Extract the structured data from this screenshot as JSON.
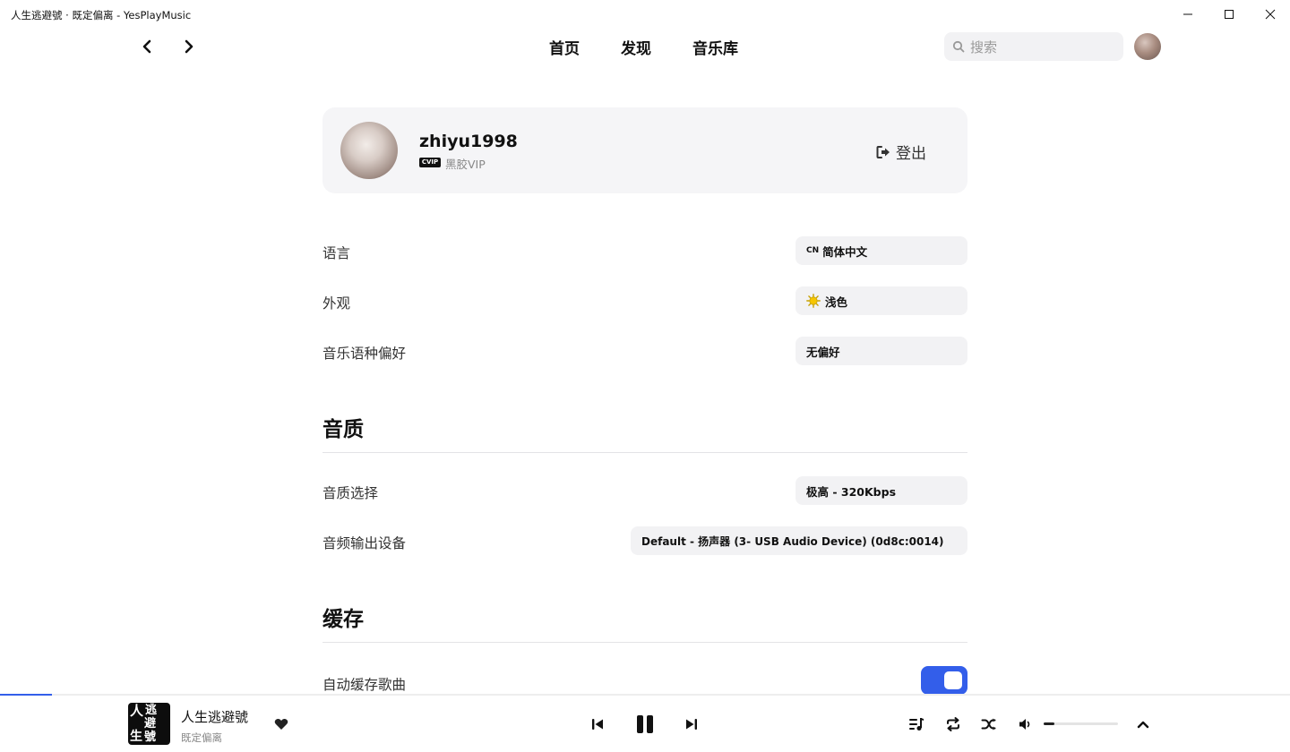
{
  "window": {
    "title": "人生逃避號 · 既定偏离 - YesPlayMusic",
    "controls": [
      "minimize-icon",
      "maximize-icon",
      "close-icon"
    ]
  },
  "nav": {
    "links": [
      "首页",
      "发现",
      "音乐库"
    ],
    "search_placeholder": "搜索"
  },
  "user": {
    "name": "zhiyu1998",
    "vip_badge": "CVIP",
    "vip_label": "黑胶VIP",
    "logout_label": "登出"
  },
  "settings": {
    "language": {
      "label": "语言",
      "flag": "CN",
      "value": "简体中文"
    },
    "appearance": {
      "label": "外观",
      "value": "浅色",
      "icon": "sun-emoji-icon"
    },
    "music_language": {
      "label": "音乐语种偏好",
      "value": "无偏好"
    },
    "quality_section": "音质",
    "quality": {
      "label": "音质选择",
      "value": "极高 - 320Kbps"
    },
    "output_device": {
      "label": "音频输出设备",
      "value": "Default - 扬声器 (3- USB Audio Device) (0d8c:0014)"
    },
    "cache_section": "缓存",
    "auto_cache": {
      "label": "自动缓存歌曲",
      "enabled": true
    }
  },
  "player": {
    "song_title": "人生逃避號",
    "artist": "既定偏离",
    "cover_text": [
      "人",
      "逃",
      "避",
      "生",
      "號"
    ],
    "progress": 0.04,
    "volume": 0.15,
    "accent_color": "#335eea"
  }
}
